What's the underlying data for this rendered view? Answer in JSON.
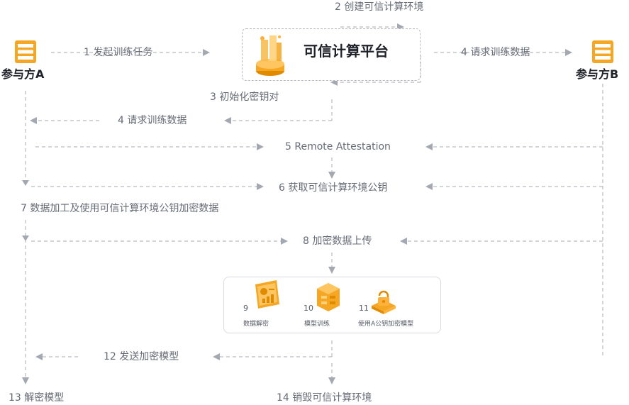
{
  "colors": {
    "accent": "#f5a623",
    "accent_dark": "#e08a00",
    "line": "#b7bac0",
    "arrow": "#a4a8b0",
    "text": "#666b75",
    "title": "#1f2329"
  },
  "participants": {
    "party_a": "参与方A",
    "party_b": "参与方B",
    "platform": "可信计算平台"
  },
  "steps": {
    "s1": "1 发起训练任务",
    "s2": "2 创建可信计算环境",
    "s3": "3 初始化密钥对",
    "s4_left": "4 请求训练数据",
    "s4_right": "4 请求训练数据",
    "s5": "5 Remote Attestation",
    "s6": "6 获取可信计算环境公钥",
    "s7": "7 数据加工及使用可信计算环境公钥加密数据",
    "s8": "8 加密数据上传",
    "s12": "12 发送加密模型",
    "s13": "13 解密模型",
    "s14": "14 销毁可信计算环境"
  },
  "panel": {
    "items": [
      {
        "num": "9",
        "label": "数据解密",
        "icon": "chart-doc-icon"
      },
      {
        "num": "10",
        "label": "模型训练",
        "icon": "model-stack-icon"
      },
      {
        "num": "11",
        "label": "使用A公钥加密模型",
        "icon": "lock-icon"
      }
    ]
  },
  "icons": {
    "party_a": "server-icon",
    "party_b": "server-icon",
    "platform": "platform-stack-icon"
  }
}
